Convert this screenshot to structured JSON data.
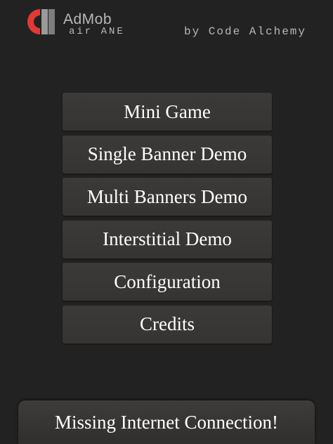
{
  "header": {
    "logo_title": "AdMob",
    "logo_subtitle": "air ANE",
    "credit": "by Code Alchemy",
    "logo_icon": "admob-logo-icon",
    "colors": {
      "logo_red": "#e03a34",
      "logo_gray": "#9a9a9a"
    }
  },
  "menu": {
    "items": [
      {
        "label": "Mini Game"
      },
      {
        "label": "Single Banner Demo"
      },
      {
        "label": "Multi Banners Demo"
      },
      {
        "label": "Interstitial Demo"
      },
      {
        "label": "Configuration"
      },
      {
        "label": "Credits"
      }
    ]
  },
  "toast": {
    "message": "Missing Internet Connection!"
  },
  "colors": {
    "background": "#222222",
    "button": "#383735",
    "text": "#ffffff",
    "header_text": "#b8b8b8"
  }
}
